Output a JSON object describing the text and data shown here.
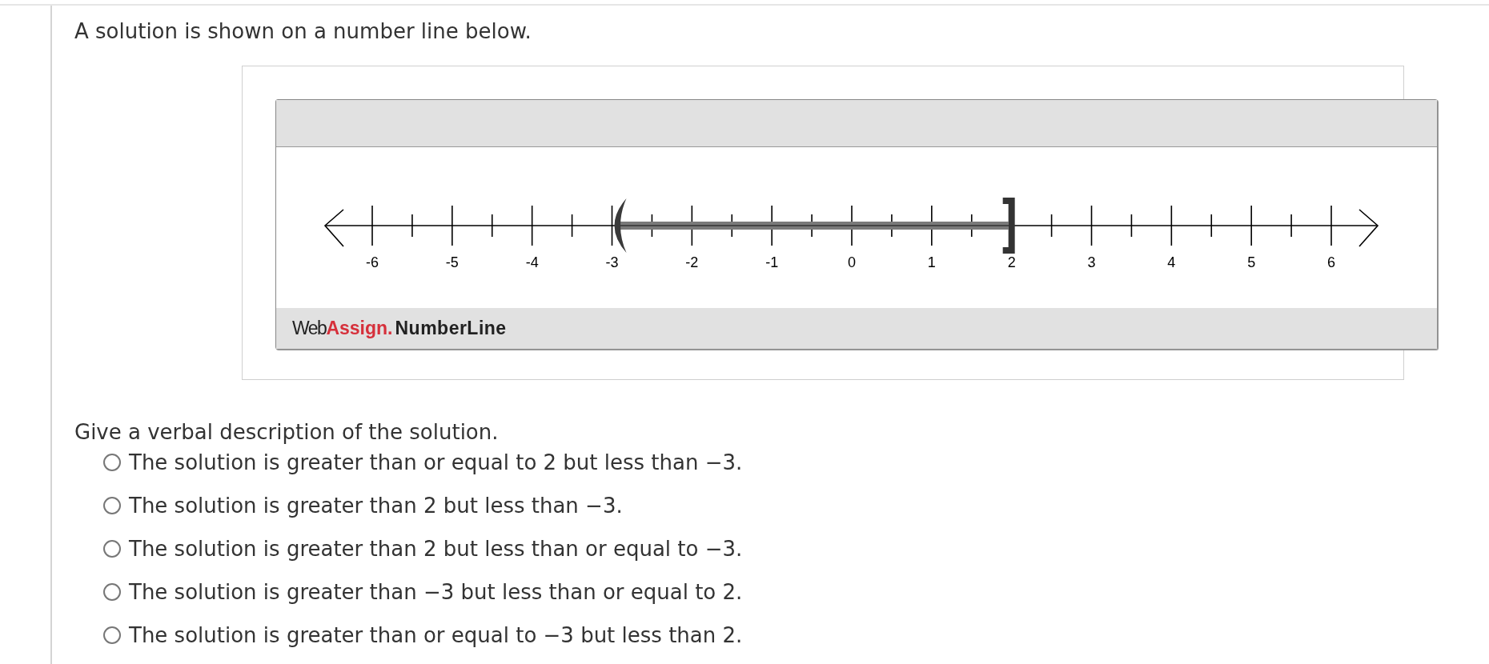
{
  "prompt": "A solution is shown on a number line below.",
  "number_line": {
    "ticks": [
      {
        "label": "-6",
        "open_endpoint": false,
        "closed_endpoint": false
      },
      {
        "label": "-5",
        "open_endpoint": false,
        "closed_endpoint": false
      },
      {
        "label": "-4",
        "open_endpoint": false,
        "closed_endpoint": false
      },
      {
        "label": "-3",
        "open_endpoint": true,
        "closed_endpoint": false
      },
      {
        "label": "-2",
        "open_endpoint": false,
        "closed_endpoint": false
      },
      {
        "label": "-1",
        "open_endpoint": false,
        "closed_endpoint": false
      },
      {
        "label": "0",
        "open_endpoint": false,
        "closed_endpoint": false
      },
      {
        "label": "1",
        "open_endpoint": false,
        "closed_endpoint": false
      },
      {
        "label": "2",
        "open_endpoint": false,
        "closed_endpoint": true
      },
      {
        "label": "3",
        "open_endpoint": false,
        "closed_endpoint": false
      },
      {
        "label": "4",
        "open_endpoint": false,
        "closed_endpoint": false
      },
      {
        "label": "5",
        "open_endpoint": false,
        "closed_endpoint": false
      },
      {
        "label": "6",
        "open_endpoint": false,
        "closed_endpoint": false
      }
    ],
    "brand": [
      {
        "text": "Web",
        "kind": "light"
      },
      {
        "text": "Assign.",
        "kind": "accent"
      },
      {
        "text": "NumberLine",
        "kind": "strong"
      }
    ]
  },
  "question": "Give a verbal description of the solution.",
  "options": [
    {
      "text": "The solution is greater than or equal to 2 but less than −3.",
      "selected": false
    },
    {
      "text": "The solution is greater than 2 but less than −3.",
      "selected": false
    },
    {
      "text": "The solution is greater than 2 but less than or equal to −3.",
      "selected": false
    },
    {
      "text": "The solution is greater than −3 but less than or equal to 2.",
      "selected": false
    },
    {
      "text": "The solution is greater than or equal to −3 but less than 2.",
      "selected": false
    }
  ]
}
